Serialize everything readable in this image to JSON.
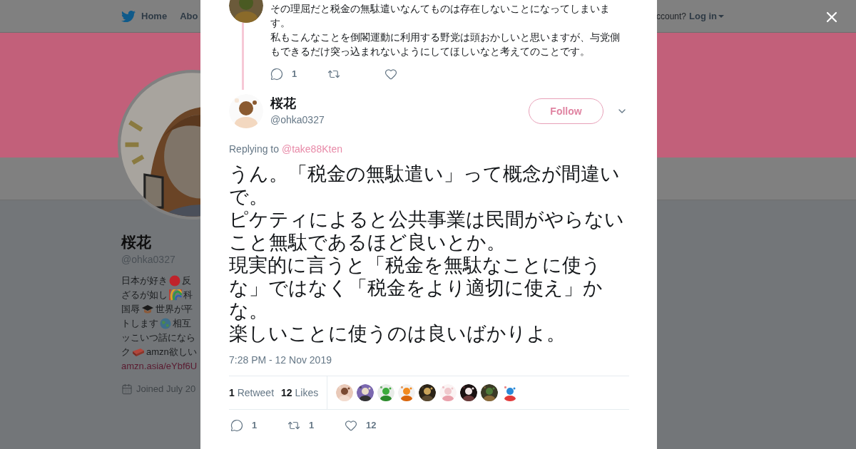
{
  "background": {
    "nav": [
      {
        "label": "Home"
      },
      {
        "label": "Abo"
      }
    ],
    "account_prompt": "ccount?",
    "login": "Log in",
    "profile": {
      "name": "桜花",
      "handle": "@ohka0327",
      "bio_lines": [
        [
          {
            "kind": "text",
            "text": "日本が好き"
          },
          {
            "kind": "emoji"
          },
          {
            "kind": "text",
            "text": "反"
          }
        ],
        [
          {
            "kind": "text",
            "text": "ざるが如し"
          },
          {
            "kind": "emoji"
          },
          {
            "kind": "text",
            "text": "科"
          }
        ],
        [
          {
            "kind": "text",
            "text": "国辱"
          },
          {
            "kind": "emoji"
          },
          {
            "kind": "text",
            "text": "世界が平"
          }
        ],
        [
          {
            "kind": "text",
            "text": "トします"
          },
          {
            "kind": "emoji"
          },
          {
            "kind": "text",
            "text": "相互"
          }
        ],
        [
          {
            "kind": "text",
            "text": "ッこいつ話になら"
          }
        ],
        [
          {
            "kind": "text",
            "text": "ク"
          },
          {
            "kind": "emoji"
          },
          {
            "kind": "text",
            "text": "amzn欲しい"
          }
        ]
      ],
      "link": "amzn.asia/eYbf6U",
      "joined": "Joined July 20"
    }
  },
  "modal": {
    "parent_tweet": {
      "paragraphs": [
        "その理屈だと税金の無駄遣いなんてものは存在しないことになってしまいます。",
        "私もこんなことを倒閣運動に利用する野党は頭おかしいと思いますが、与党側もできるだけ突っ込まれないようにしてほしいなと考えてのことです。"
      ],
      "reply_count": "1"
    },
    "tweet": {
      "name": "桜花",
      "handle": "@ohka0327",
      "follow_label": "Follow",
      "replying_label": "Replying to",
      "replying_to": "@take88Kten",
      "paragraphs": [
        "うん。「税金の無駄遣い」って概念が間違いで。",
        "ピケティによると公共事業は民間がやらないこと無駄であるほど良いとか。",
        "現実的に言うと「税金を無駄なことに使うな」ではなく「税金をより適切に使え」かな。",
        "楽しいことに使うのは良いばかりよ。"
      ],
      "time": "7:28 PM - 12 Nov 2019",
      "stats": [
        {
          "count": "1",
          "label": "Retweet"
        },
        {
          "count": "12",
          "label": "Likes"
        }
      ],
      "reply_count": "1",
      "retweet_count": "1",
      "like_count": "12"
    }
  }
}
